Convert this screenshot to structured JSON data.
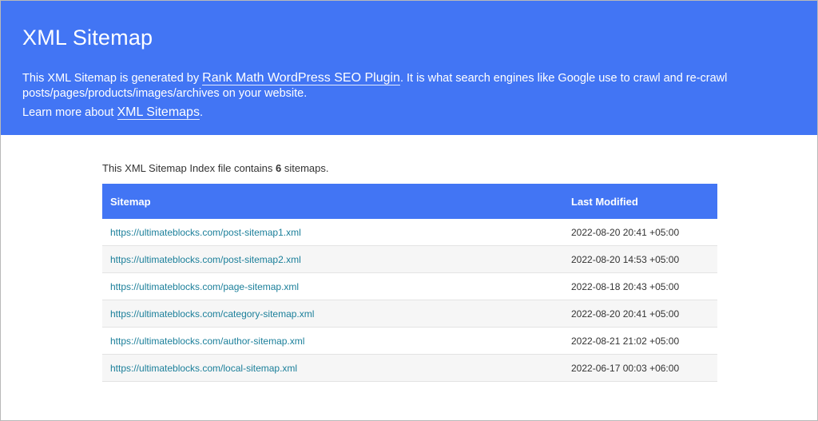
{
  "header": {
    "title": "XML Sitemap",
    "desc_prefix": "This XML Sitemap is generated by ",
    "plugin_link": "Rank Math WordPress SEO Plugin",
    "desc_suffix": ". It is what search engines like Google use to crawl and re-crawl posts/pages/products/images/archives on your website.",
    "learn_prefix": "Learn more about ",
    "learn_link": "XML Sitemaps",
    "learn_suffix": "."
  },
  "summary": {
    "prefix": "This XML Sitemap Index file contains ",
    "count": "6",
    "suffix": " sitemaps."
  },
  "table": {
    "headers": [
      "Sitemap",
      "Last Modified"
    ],
    "rows": [
      {
        "url": "https://ultimateblocks.com/post-sitemap1.xml",
        "modified": "2022-08-20 20:41 +05:00"
      },
      {
        "url": "https://ultimateblocks.com/post-sitemap2.xml",
        "modified": "2022-08-20 14:53 +05:00"
      },
      {
        "url": "https://ultimateblocks.com/page-sitemap.xml",
        "modified": "2022-08-18 20:43 +05:00"
      },
      {
        "url": "https://ultimateblocks.com/category-sitemap.xml",
        "modified": "2022-08-20 20:41 +05:00"
      },
      {
        "url": "https://ultimateblocks.com/author-sitemap.xml",
        "modified": "2022-08-21 21:02 +05:00"
      },
      {
        "url": "https://ultimateblocks.com/local-sitemap.xml",
        "modified": "2022-06-17 00:03 +06:00"
      }
    ]
  },
  "colors": {
    "brand": "#4275f4",
    "link": "#1b7f9a",
    "row_alt": "#f6f6f6"
  }
}
